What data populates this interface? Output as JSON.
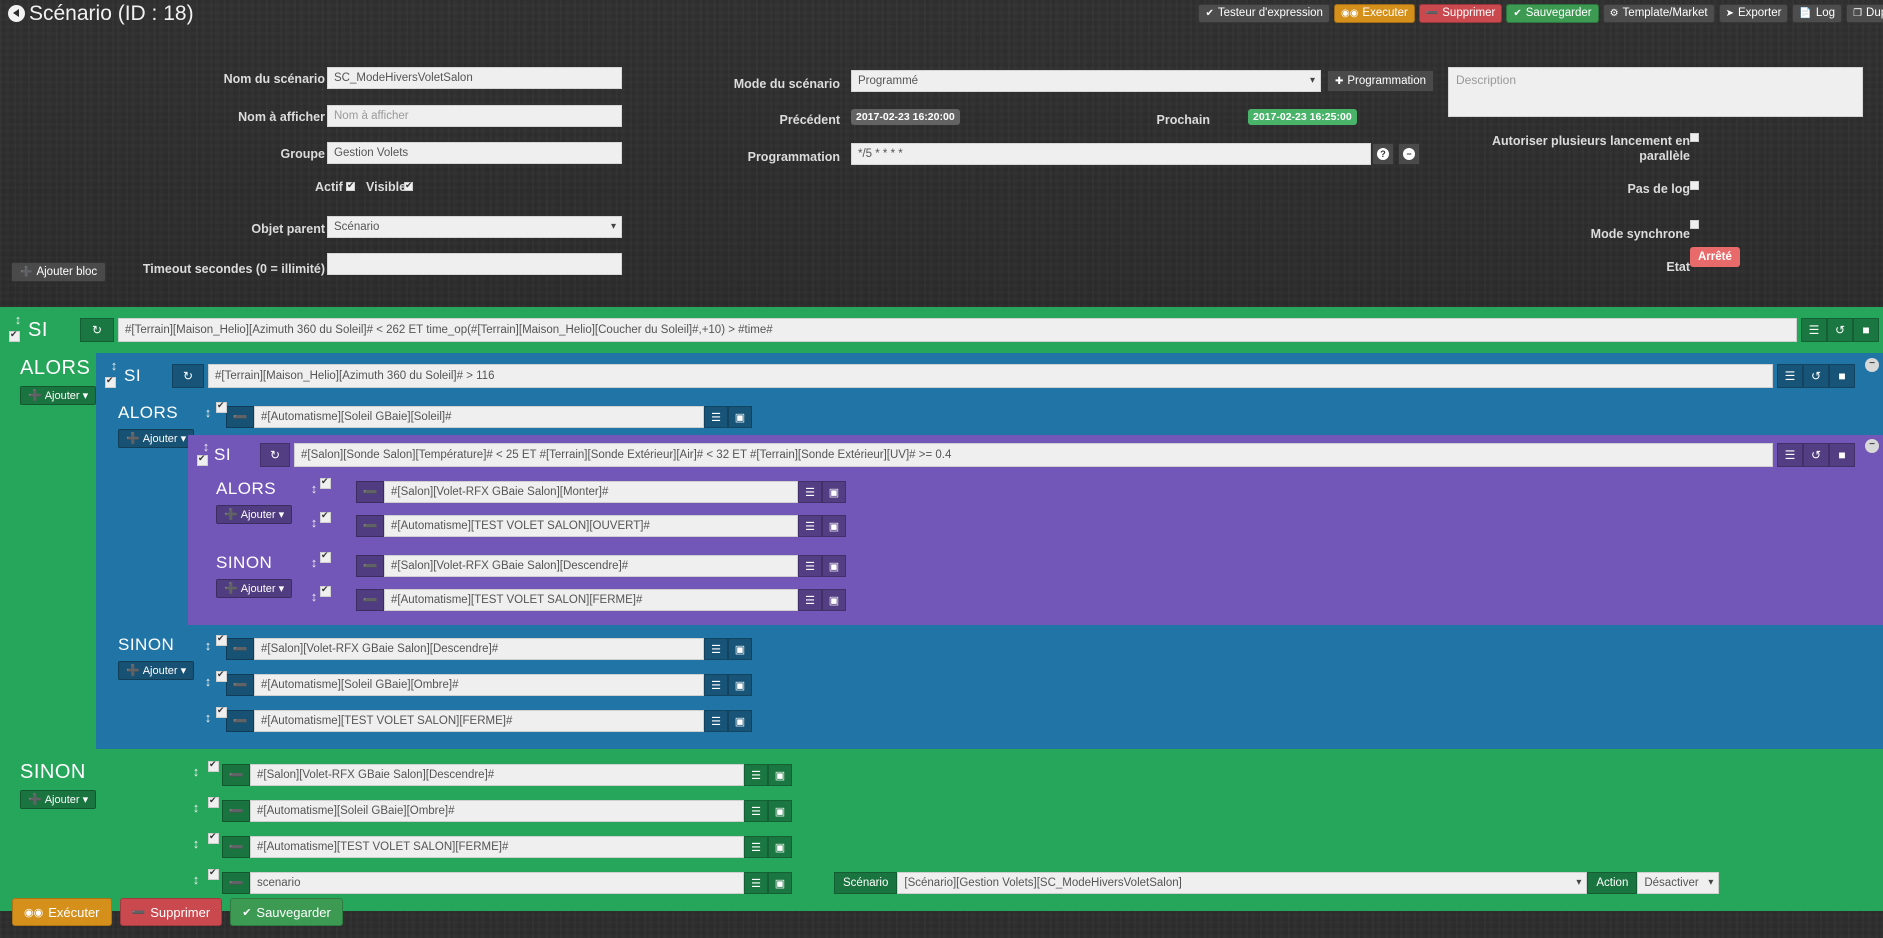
{
  "header": {
    "title": "Scénario (ID : 18)",
    "back_icon": "back-arrow-icon"
  },
  "toolbar": [
    {
      "label": "Testeur d'expression",
      "icon": "check-icon",
      "style": "grey"
    },
    {
      "label": "Executer",
      "icon": "play-icon",
      "style": "orange"
    },
    {
      "label": "Supprimer",
      "icon": "minus-circle-icon",
      "style": "red"
    },
    {
      "label": "Sauvegarder",
      "icon": "check-circle-icon",
      "style": "green"
    },
    {
      "label": "Template/Market",
      "icon": "share-icon",
      "style": "grey"
    },
    {
      "label": "Exporter",
      "icon": "arrow-right-icon",
      "style": "grey"
    },
    {
      "label": "Log",
      "icon": "file-icon",
      "style": "grey"
    },
    {
      "label": "Duplic",
      "icon": "copy-icon",
      "style": "grey"
    }
  ],
  "form": {
    "nom_scenario_label": "Nom du scénario",
    "nom_scenario_value": "SC_ModeHiversVoletSalon",
    "nom_afficher_label": "Nom à afficher",
    "nom_afficher_placeholder": "Nom à afficher",
    "groupe_label": "Groupe",
    "groupe_value": "Gestion Volets",
    "actif_label": "Actif",
    "visible_label": "Visible",
    "objet_parent_label": "Objet parent",
    "objet_parent_value": "Scénario",
    "timeout_label": "Timeout secondes (0 = illimité)",
    "timeout_value": "",
    "mode_label": "Mode du scénario",
    "mode_value": "Programmé",
    "btn_programmation": "Programmation",
    "precedent_label": "Précédent",
    "precedent_value": "2017-02-23 16:20:00",
    "prochain_label": "Prochain",
    "prochain_value": "2017-02-23 16:25:00",
    "programmation_label": "Programmation",
    "programmation_value": "*/5 * * * *",
    "help_icon": "question-mark-icon",
    "remove_icon": "minus-circle-icon",
    "description_placeholder": "Description",
    "parallele_label": "Autoriser plusieurs lancement en parallèle",
    "pas_de_log_label": "Pas de log",
    "mode_synchrone_label": "Mode synchrone",
    "etat_label": "Etat",
    "etat_value": "Arrêté"
  },
  "ajouter_bloc_label": "Ajouter bloc",
  "labels": {
    "si": "SI",
    "alors": "ALORS",
    "sinon": "SINON",
    "ajouter": "Ajouter",
    "action": "Action",
    "scenario": "Scénario",
    "desactiver": "Désactiver"
  },
  "blocks": {
    "green_si_condition": "#[Terrain][Maison_Helio][Azimuth 360 du Soleil]# < 262 ET  time_op(#[Terrain][Maison_Helio][Coucher du Soleil]#,+10) > #time#",
    "blue_si_condition": "#[Terrain][Maison_Helio][Azimuth 360 du Soleil]# > 116",
    "blue_alors_action": "#[Automatisme][Soleil GBaie][Soleil]#",
    "purple_si_condition": "#[Salon][Sonde Salon][Température]# < 25 ET #[Terrain][Sonde Extérieur][Air]# < 32 ET #[Terrain][Sonde Extérieur][UV]# >= 0.4",
    "purple_alors_actions": [
      "#[Salon][Volet-RFX GBaie Salon][Monter]#",
      "#[Automatisme][TEST VOLET SALON][OUVERT]#"
    ],
    "purple_sinon_actions": [
      "#[Salon][Volet-RFX GBaie Salon][Descendre]#",
      "#[Automatisme][TEST VOLET SALON][FERME]#"
    ],
    "blue_sinon_actions": [
      "#[Salon][Volet-RFX GBaie Salon][Descendre]#",
      "#[Automatisme][Soleil GBaie][Ombre]#",
      "#[Automatisme][TEST VOLET SALON][FERME]#"
    ],
    "green_sinon_actions": [
      "#[Salon][Volet-RFX GBaie Salon][Descendre]#",
      "#[Automatisme][Soleil GBaie][Ombre]#",
      "#[Automatisme][TEST VOLET SALON][FERME]#",
      "scenario"
    ],
    "green_sinon_scenario_select": "[Scénario][Gestion Volets][SC_ModeHiversVoletSalon]"
  },
  "bottom_buttons": [
    {
      "label": "Exécuter",
      "icon": "play-icon",
      "style": "orange"
    },
    {
      "label": "Supprimer",
      "icon": "minus-circle-icon",
      "style": "red"
    },
    {
      "label": "Sauvegarder",
      "icon": "check-circle-icon",
      "style": "green"
    }
  ],
  "colors": {
    "green": "#26a65b",
    "blue": "#2175a6",
    "purple": "#7357b8",
    "orange": "#d5901c",
    "red": "#c9494f",
    "background": "#2b2b2b"
  }
}
